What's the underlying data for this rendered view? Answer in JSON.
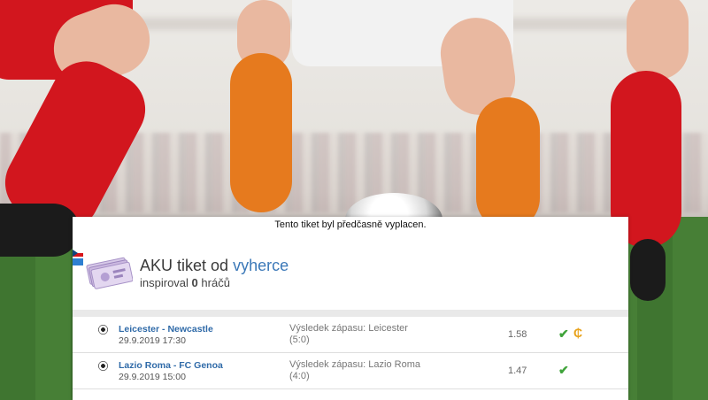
{
  "notice": "Tento tiket byl předčasně vyplacen.",
  "ticket": {
    "title_prefix": "AKU tiket od",
    "username": "vyherce",
    "inspired_prefix": "inspiroval",
    "inspired_count": "0",
    "inspired_suffix": "hráčů"
  },
  "bets": [
    {
      "match": "Leicester - Newcastle",
      "date": "29.9.2019 17:30",
      "result_line1": "Výsledek zápasu: Leicester",
      "result_line2": "(5:0)",
      "odds": "1.58",
      "status_icon": "check-icon",
      "cashout_icon": "cashout-icon"
    },
    {
      "match": "Lazio Roma - FC Genoa",
      "date": "29.9.2019 15:00",
      "result_line1": "Výsledek zápasu: Lazio Roma",
      "result_line2": "(4:0)",
      "odds": "1.47",
      "status_icon": "check-icon"
    }
  ],
  "colors": {
    "username": "#3b78b8",
    "match_link": "#2f6aa8",
    "check": "#3fa33a",
    "cashout": "#e8a21b"
  }
}
